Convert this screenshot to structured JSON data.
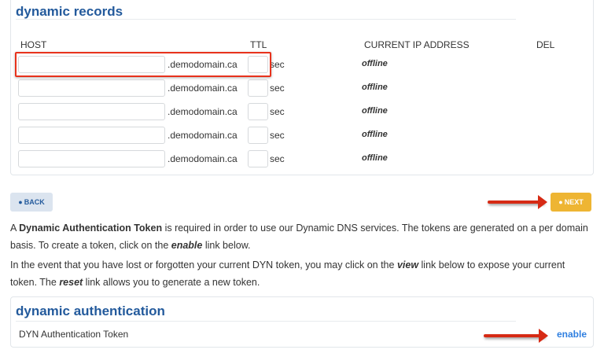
{
  "records": {
    "title": "dynamic records",
    "headers": {
      "host": "HOST",
      "ttl": "TTL",
      "ip": "CURRENT IP ADDRESS",
      "del": "DEL"
    },
    "rows": [
      {
        "host": "",
        "domain": ".demodomain.ca",
        "ttl": "",
        "unit": "sec",
        "ip": "offline"
      },
      {
        "host": "",
        "domain": ".demodomain.ca",
        "ttl": "",
        "unit": "sec",
        "ip": "offline"
      },
      {
        "host": "",
        "domain": ".demodomain.ca",
        "ttl": "",
        "unit": "sec",
        "ip": "offline"
      },
      {
        "host": "",
        "domain": ".demodomain.ca",
        "ttl": "",
        "unit": "sec",
        "ip": "offline"
      },
      {
        "host": "",
        "domain": ".demodomain.ca",
        "ttl": "",
        "unit": "sec",
        "ip": "offline"
      }
    ]
  },
  "nav": {
    "back": "BACK",
    "next": "NEXT"
  },
  "info": {
    "p1_a": "A ",
    "p1_b": "Dynamic Authentication Token",
    "p1_c": " is required in order to use our Dynamic DNS services. The tokens are generated on a per domain basis. To create a token, click on the ",
    "p1_d": "enable",
    "p1_e": " link below.",
    "p2_a": "In the event that you have lost or forgotten your current DYN token, you may click on the ",
    "p2_b": "view",
    "p2_c": " link below to expose your current token. The ",
    "p2_d": "reset",
    "p2_e": " link allows you to generate a new token."
  },
  "auth": {
    "title": "dynamic authentication",
    "label": "DYN Authentication Token",
    "link": "enable"
  },
  "colors": {
    "title": "#235a9c",
    "next": "#eeb533",
    "back": "#dbe4ef",
    "link": "#2f7fe0",
    "highlight": "#e8321c"
  }
}
